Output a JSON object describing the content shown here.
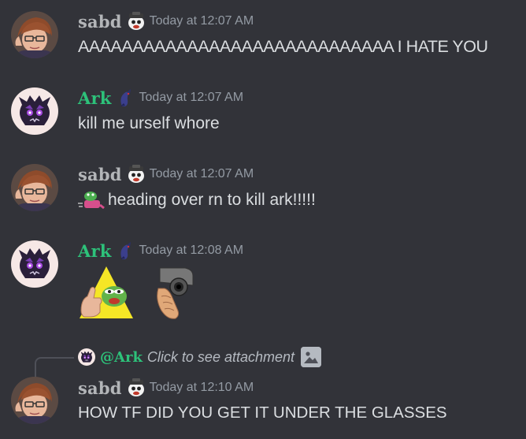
{
  "theme": {
    "background": "#323339",
    "text": "#dbdee1",
    "timestamp": "#949ba4",
    "sabd_color": "#b3b5b8",
    "ark_color": "#2dc27a"
  },
  "messages": [
    {
      "author": "sabd",
      "timestamp": "Today at 12:07 AM",
      "text": "AAAAAAAAAAAAAAAAAAAAAAAAAAAAA I HATE YOU"
    },
    {
      "author": "Ark",
      "timestamp": "Today at 12:07 AM",
      "text": "kill me urself whore"
    },
    {
      "author": "sabd",
      "timestamp": "Today at 12:07 AM",
      "text": "heading over rn to kill ark!!!!!",
      "emoji": "pepe-run-emoji"
    },
    {
      "author": "Ark",
      "timestamp": "Today at 12:08 AM",
      "emojis": [
        "pepe-thumbs-up-emoji",
        "pointing-gun-emoji"
      ]
    },
    {
      "author": "sabd",
      "timestamp": "Today at 12:10 AM",
      "text": "HOW TF DID YOU GET IT UNDER THE GLASSES",
      "reply": {
        "mention": "@Ark",
        "text": "Click to see attachment",
        "icon": "image-icon"
      }
    }
  ]
}
